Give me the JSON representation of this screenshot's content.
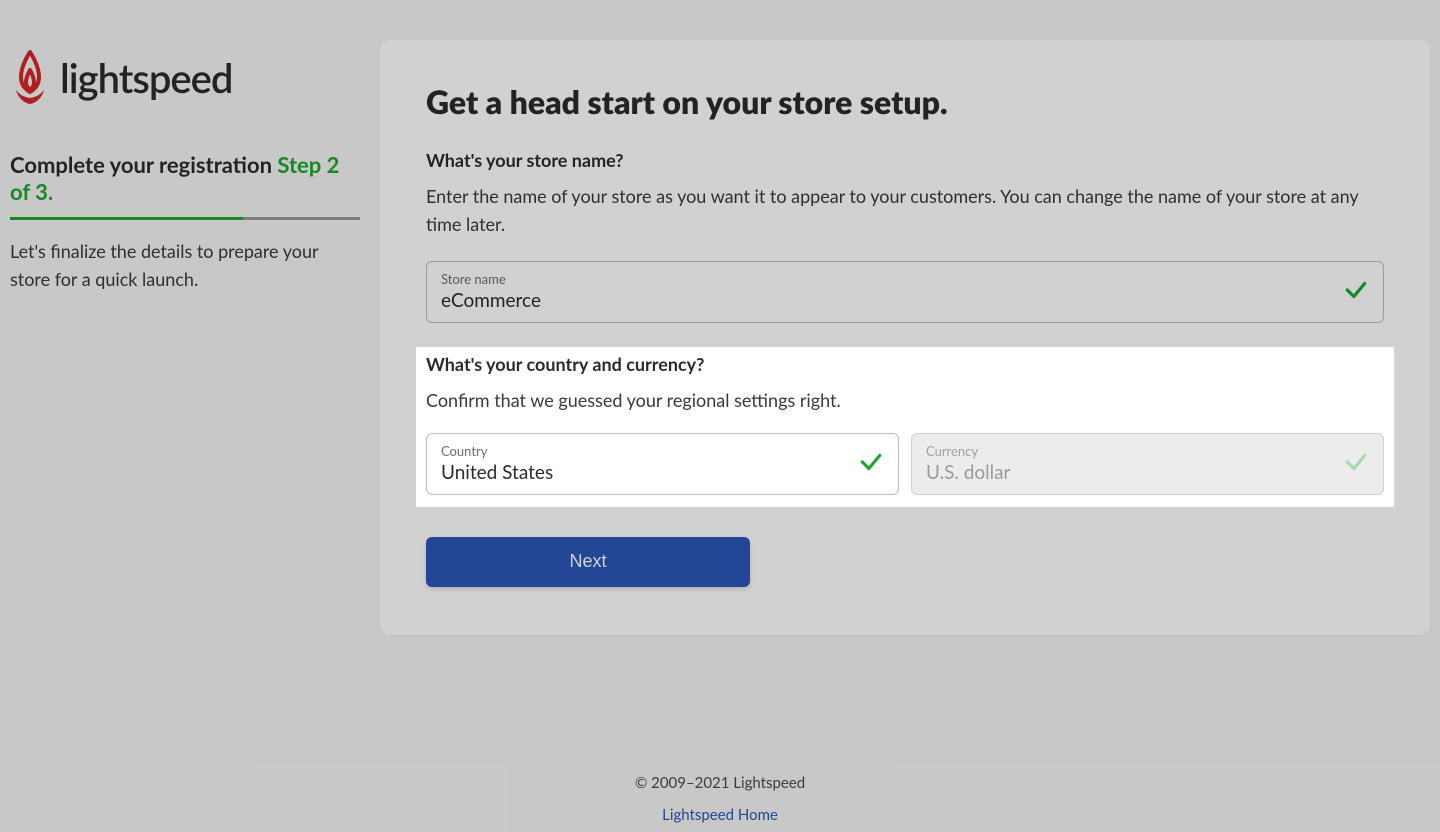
{
  "brand": {
    "name": "lightspeed"
  },
  "sidebar": {
    "title_prefix": "Complete your registration",
    "step_label": "Step 2 of 3.",
    "progress_pct": 66.6,
    "description": "Let's finalize the details to prepare your store for a quick launch."
  },
  "form": {
    "heading": "Get a head start on your store setup.",
    "store_name": {
      "label": "What's your store name?",
      "description": "Enter the name of your store as you want it to appear to your customers. You can change the name of your store at any time later.",
      "field_label": "Store name",
      "value": "eCommerce"
    },
    "region": {
      "label": "What's your country and currency?",
      "description": "Confirm that we guessed your regional settings right.",
      "country_label": "Country",
      "country_value": "United States",
      "currency_label": "Currency",
      "currency_value": "U.S. dollar"
    },
    "next_label": "Next"
  },
  "footer": {
    "copyright": "© 2009–2021 Lightspeed",
    "home_link": "Lightspeed Home"
  },
  "colors": {
    "accent_green": "#1fa52a",
    "primary_blue": "#2b56b8",
    "brand_red": "#d6262a"
  }
}
